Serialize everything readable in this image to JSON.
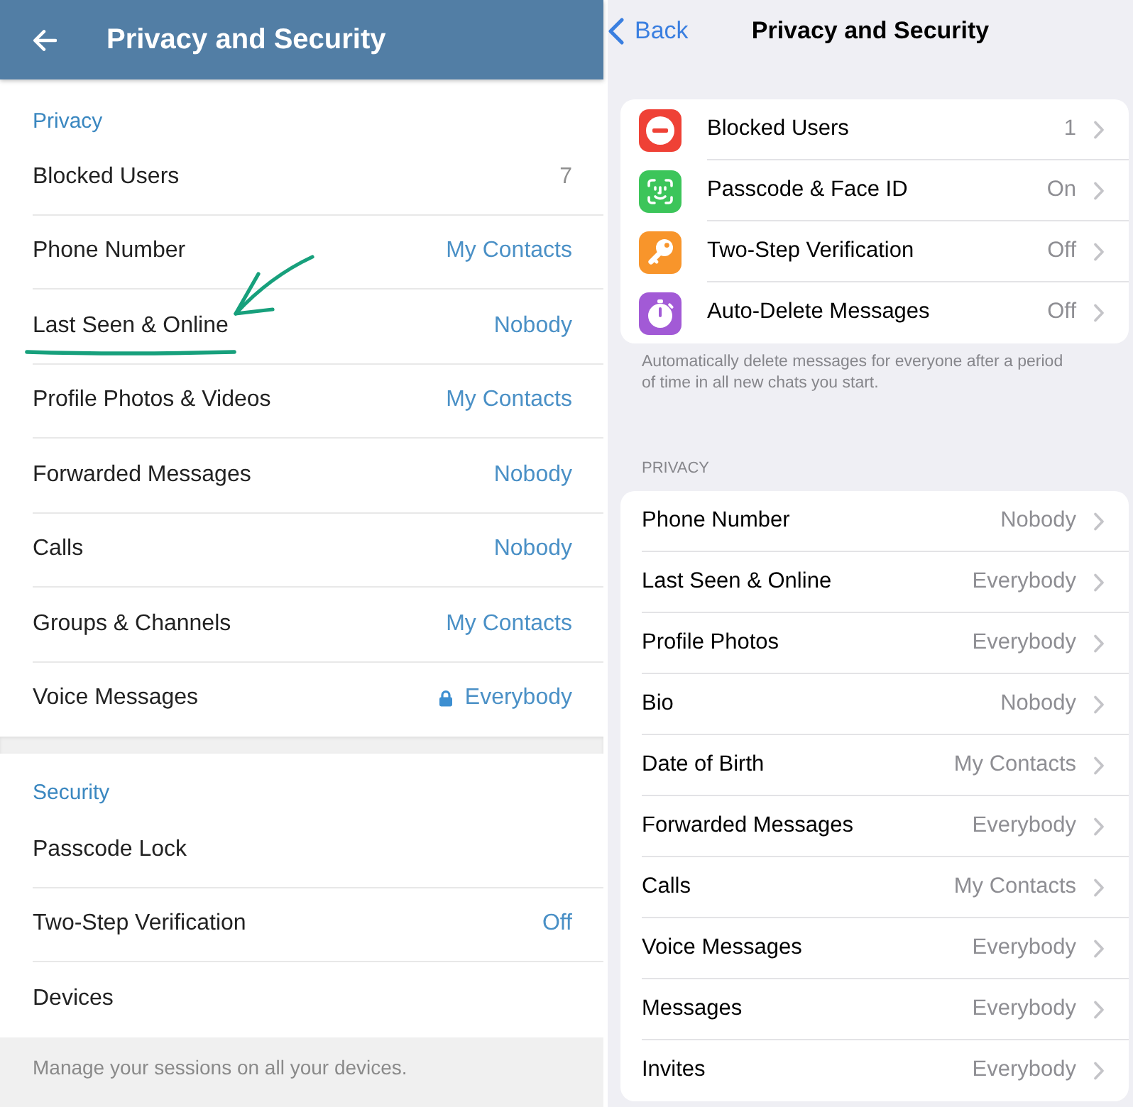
{
  "android_screen": {
    "header": {
      "title": "Privacy and Security"
    },
    "sections": [
      {
        "title": "Privacy",
        "rows": [
          {
            "label": "Blocked Users",
            "value": "7",
            "kind": "count",
            "locked": false,
            "annotated": false
          },
          {
            "label": "Phone Number",
            "value": "My Contacts",
            "kind": "option",
            "locked": false,
            "annotated": false
          },
          {
            "label": "Last Seen & Online",
            "value": "Nobody",
            "kind": "option",
            "locked": false,
            "annotated": true
          },
          {
            "label": "Profile Photos & Videos",
            "value": "My Contacts",
            "kind": "option",
            "locked": false,
            "annotated": false
          },
          {
            "label": "Forwarded Messages",
            "value": "Nobody",
            "kind": "option",
            "locked": false,
            "annotated": false
          },
          {
            "label": "Calls",
            "value": "Nobody",
            "kind": "option",
            "locked": false,
            "annotated": false
          },
          {
            "label": "Groups & Channels",
            "value": "My Contacts",
            "kind": "option",
            "locked": false,
            "annotated": false
          },
          {
            "label": "Voice Messages",
            "value": "Everybody",
            "kind": "option",
            "locked": true,
            "annotated": false
          }
        ]
      },
      {
        "title": "Security",
        "rows": [
          {
            "label": "Passcode Lock",
            "locked": false,
            "annotated": false
          },
          {
            "label": "Two-Step Verification",
            "value": "Off",
            "kind": "option",
            "locked": false,
            "annotated": false
          },
          {
            "label": "Devices",
            "locked": false,
            "annotated": false
          }
        ]
      }
    ],
    "footer": "Manage your sessions on all your devices."
  },
  "ios_screen": {
    "nav": {
      "back": "Back",
      "title": "Privacy and Security"
    },
    "security_group": {
      "rows": [
        {
          "kind": "blocked",
          "color": "#ef4136",
          "label": "Blocked Users",
          "value": "1"
        },
        {
          "kind": "faceid",
          "color": "#3cc55a",
          "label": "Passcode & Face ID",
          "value": "On"
        },
        {
          "kind": "key",
          "color": "#f8952b",
          "label": "Two-Step Verification",
          "value": "Off"
        },
        {
          "kind": "timer",
          "color": "#a25ad6",
          "label": "Auto-Delete Messages",
          "value": "Off"
        }
      ],
      "footer": "Automatically delete messages for everyone after a period of time in all new chats you start."
    },
    "privacy_group": {
      "header": "PRIVACY",
      "rows": [
        {
          "label": "Phone Number",
          "value": "Nobody"
        },
        {
          "label": "Last Seen & Online",
          "value": "Everybody"
        },
        {
          "label": "Profile Photos",
          "value": "Everybody"
        },
        {
          "label": "Bio",
          "value": "Nobody"
        },
        {
          "label": "Date of Birth",
          "value": "My Contacts"
        },
        {
          "label": "Forwarded Messages",
          "value": "Everybody"
        },
        {
          "label": "Calls",
          "value": "My Contacts"
        },
        {
          "label": "Voice Messages",
          "value": "Everybody"
        },
        {
          "label": "Messages",
          "value": "Everybody"
        },
        {
          "label": "Invites",
          "value": "Everybody"
        }
      ]
    }
  }
}
